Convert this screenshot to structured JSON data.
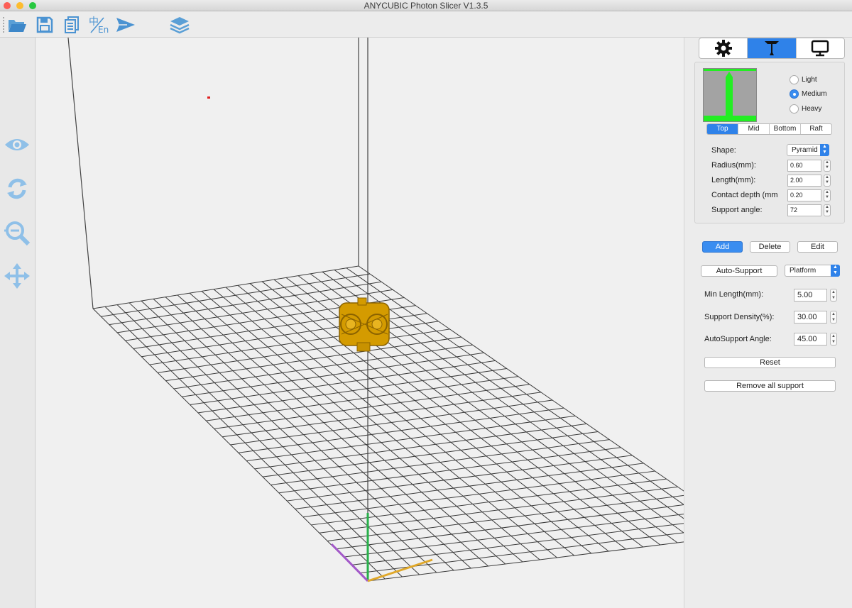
{
  "window": {
    "title": "ANYCUBIC Photon Slicer V1.3.5"
  },
  "toolbar": {
    "items": [
      "open-folder",
      "save",
      "copy",
      "language-zh-en",
      "send",
      "layers"
    ]
  },
  "left_tools": [
    "eye",
    "rotate",
    "zoom",
    "move"
  ],
  "colors": {
    "accent": "#2f82e9",
    "icon_blue": "#5a9fd6",
    "model": "#d49b00",
    "support_green": "#22ee22"
  },
  "panel": {
    "tabs": [
      "settings",
      "support",
      "display"
    ],
    "density": {
      "options": [
        "Light",
        "Medium",
        "Heavy"
      ],
      "selected": "Medium"
    },
    "support_parts": {
      "tabs": [
        "Top",
        "Mid",
        "Bottom",
        "Raft"
      ],
      "selected": "Top"
    },
    "fields": {
      "shape_label": "Shape:",
      "shape_value": "Pyramid",
      "radius_label": "Radius(mm):",
      "radius_value": "0.60",
      "length_label": "Length(mm):",
      "length_value": "2.00",
      "contact_label": "Contact depth (mm",
      "contact_value": "0.20",
      "angle_label": "Support angle:",
      "angle_value": "72"
    },
    "actions": {
      "add": "Add",
      "delete": "Delete",
      "edit": "Edit"
    },
    "auto": {
      "button": "Auto-Support",
      "mode": "Platform",
      "min_length_label": "Min Length(mm):",
      "min_length_value": "5.00",
      "density_label": "Support Density(%):",
      "density_value": "30.00",
      "angle_label": "AutoSupport Angle:",
      "angle_value": "45.00",
      "reset": "Reset",
      "remove_all": "Remove all support"
    }
  }
}
